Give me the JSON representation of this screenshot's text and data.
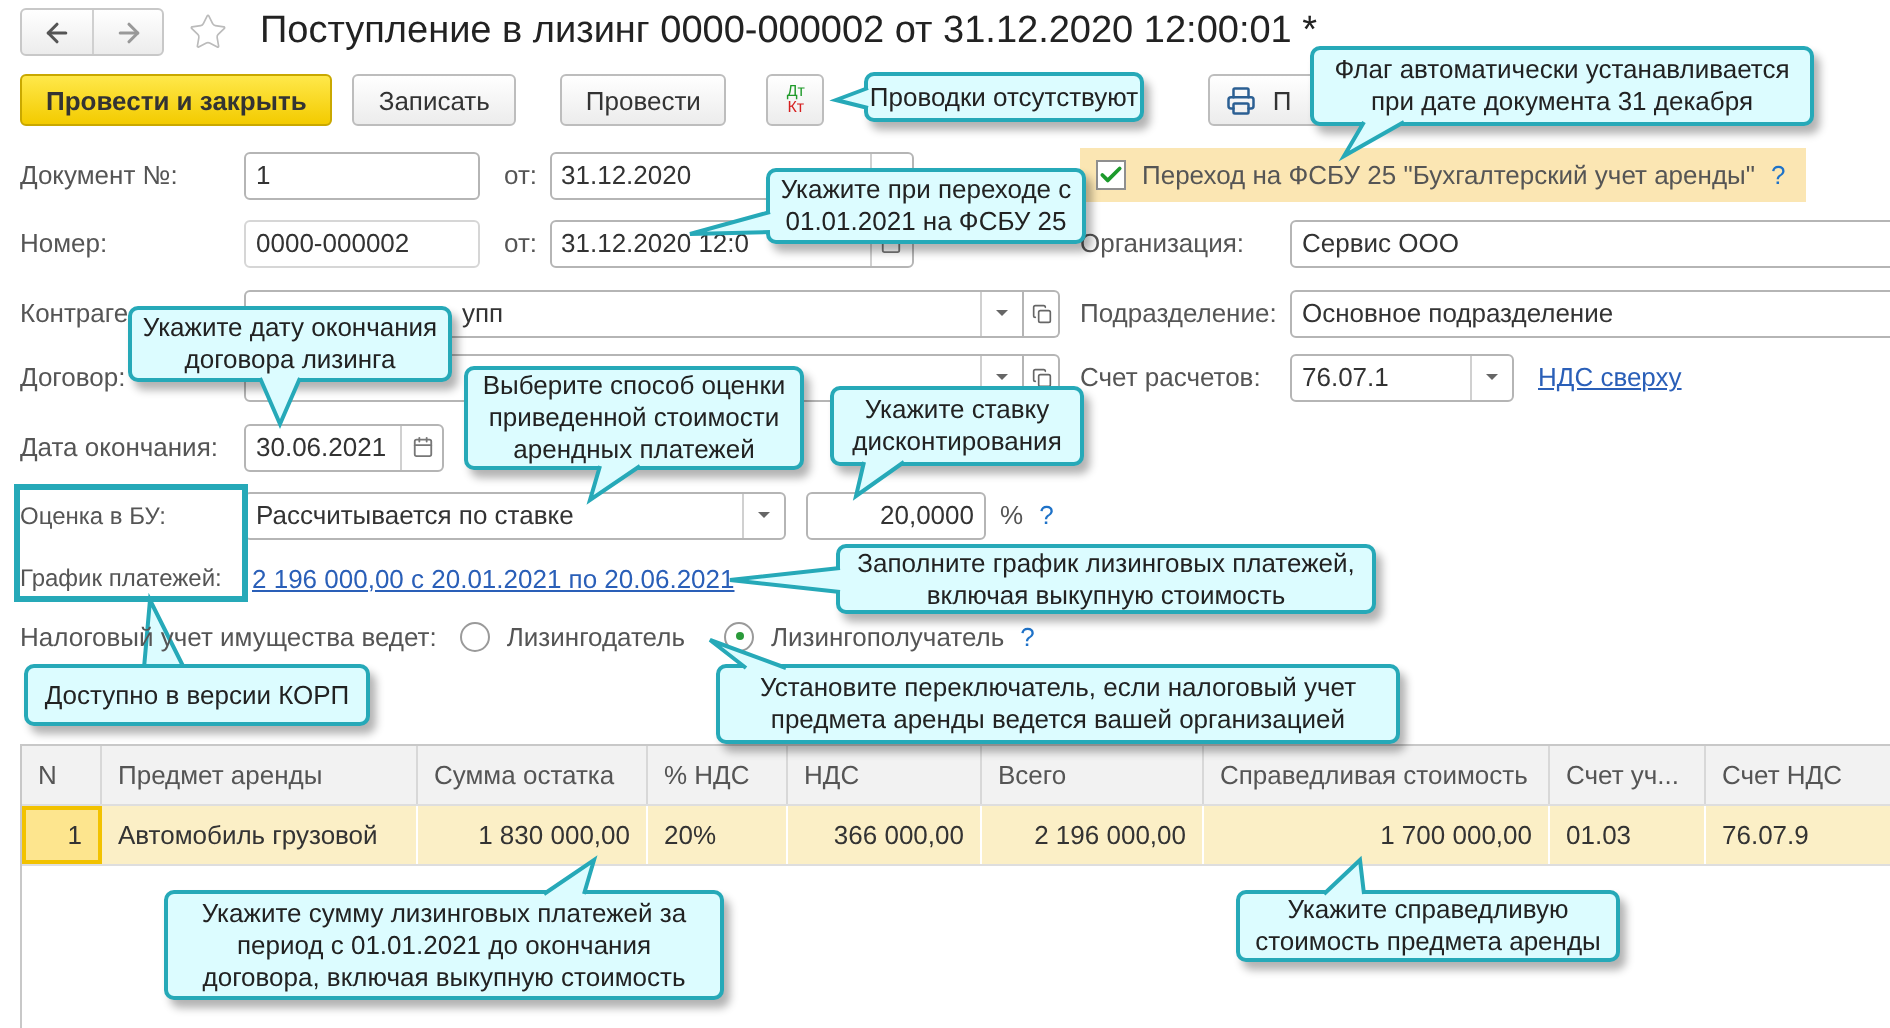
{
  "window": {
    "title": "Поступление в лизинг 0000-000002 от 31.12.2020 12:00:01 *",
    "favorite": false
  },
  "toolbar": {
    "buttons": [
      {
        "label": "Провести и закрыть",
        "kind": "primary"
      },
      {
        "label": "Записать",
        "kind": "normal"
      },
      {
        "label": "Провести",
        "kind": "normal"
      }
    ],
    "dt": "Дт",
    "kt": "Кт",
    "print_label": "П"
  },
  "document_no": {
    "label": "Документ №:",
    "value": "1",
    "date_label": "от:",
    "date": "31.12.2020"
  },
  "number": {
    "label": "Номер:",
    "value": "0000-000002",
    "date_label": "от:",
    "date": "31.12.2020 12:0"
  },
  "fsbu_transition": {
    "label": "Переход на ФСБУ 25 \"Бухгалтерский учет аренды\"",
    "checked": true,
    "help": "?"
  },
  "organization": {
    "label": "Организация:",
    "value": "Сервис ООО"
  },
  "counterparty": {
    "label": "Контраге",
    "value": "упп"
  },
  "division": {
    "label": "Подразделение:",
    "value": "Основное подразделение"
  },
  "contract": {
    "label": "Договор:"
  },
  "settlement_account": {
    "label": "Счет расчетов:",
    "value": "76.07.1",
    "link": "НДС сверху"
  },
  "end_date": {
    "label": "Дата окончания:",
    "value": "30.06.2021"
  },
  "accounting_estimate": {
    "label": "Оценка в БУ:",
    "value": "Рассчитывается по ставке",
    "rate": "20,0000",
    "unit": "%",
    "help": "?"
  },
  "payment_schedule": {
    "label": "График платежей:",
    "link": "2 196 000,00 с 20.01.2021 по 20.06.2021"
  },
  "tax_accounting": {
    "label": "Налоговый учет имущества ведет:",
    "help": "?",
    "options": [
      {
        "label": "Лизингодатель",
        "selected": false
      },
      {
        "label": "Лизингополучатель",
        "selected": true
      }
    ]
  },
  "table": {
    "columns": [
      "N",
      "Предмет аренды",
      "Сумма остатка",
      "% НДС",
      "НДС",
      "Всего",
      "Справедливая стоимость",
      "Счет уч...",
      "Счет НДС"
    ],
    "rows": [
      {
        "selected": true,
        "cells": [
          "1",
          "Автомобиль грузовой",
          "1 830 000,00",
          "20%",
          "366 000,00",
          "2 196 000,00",
          "1 700 000,00",
          "01.03",
          "76.07.9"
        ]
      }
    ]
  },
  "callouts": [
    {
      "lines": [
        "Проводки отсутствуют"
      ]
    },
    {
      "lines": [
        "Флаг автоматически устанавливается",
        "при дате документа 31 декабря"
      ]
    },
    {
      "lines": [
        "Укажите при переходе с",
        "01.01.2021 на ФСБУ 25"
      ]
    },
    {
      "lines": [
        "Укажите дату окончания",
        "договора лизинга"
      ]
    },
    {
      "lines": [
        "Выберите способ оценки",
        "приведенной стоимости",
        "арендных платежей"
      ]
    },
    {
      "lines": [
        "Укажите ставку",
        "дисконтирования"
      ]
    },
    {
      "lines": [
        "Заполните график лизинговых платежей,",
        "включая выкупную стоимость"
      ]
    },
    {
      "lines": [
        "Доступно в версии КОРП"
      ]
    },
    {
      "lines": [
        "Установите переключатель, если налоговый учет",
        "предмета аренды ведется вашей организацией"
      ]
    },
    {
      "lines": [
        "Укажите сумму лизинговых платежей за",
        "период с 01.01.2021 до окончания",
        "договора, включая выкупную стоимость"
      ]
    },
    {
      "lines": [
        "Укажите справедливую",
        "стоимость предмета аренды"
      ]
    }
  ]
}
